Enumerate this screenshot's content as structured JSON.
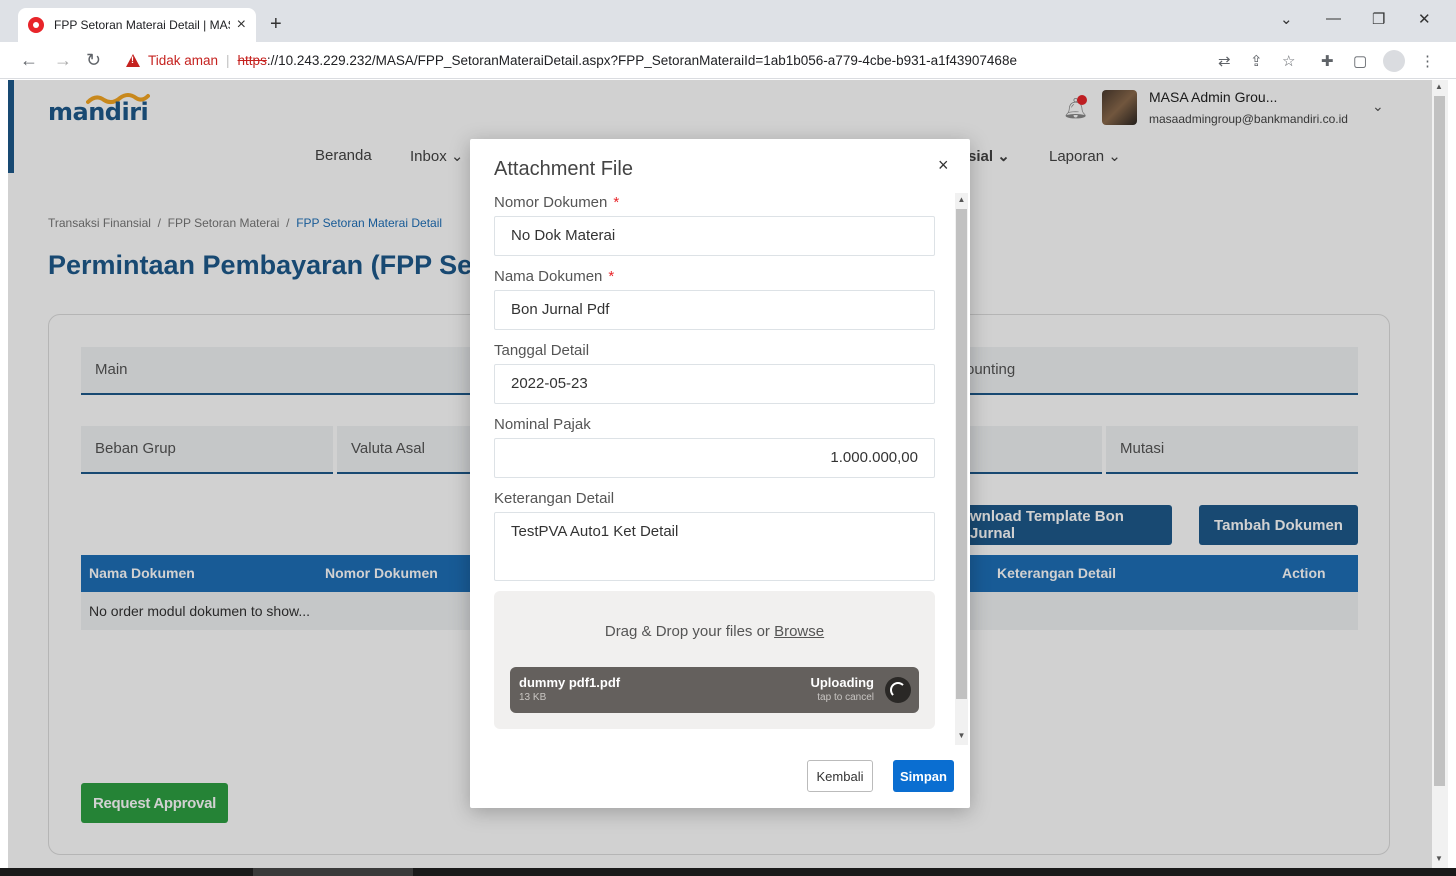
{
  "browser": {
    "tab_title": "FPP Setoran Materai Detail | MAS",
    "new_tab": "+",
    "close_tab": "×",
    "not_secure": "Tidak aman",
    "url_scheme": "https",
    "url_rest": "://10.243.229.232/MASA/FPP_SetoranMateraiDetail.aspx?FPP_SetoranMateraiId=1ab1b056-a779-4cbe-b931-a1f43907468e"
  },
  "header": {
    "logo": "mandiri",
    "user_name": "MASA Admin Grou...",
    "user_email": "masaadmingroup@bankmandiri.co.id",
    "nav": [
      "Beranda",
      "Inbox",
      "sial",
      "Laporan"
    ]
  },
  "breadcrumb": [
    "Transaksi Finansial",
    "FPP Setoran Materai",
    "FPP Setoran Materai Detail"
  ],
  "page_title": "Permintaan Pembayaran (FPP Seto",
  "tabs": {
    "main": "Main",
    "accounting": "ounting"
  },
  "fields": {
    "beban_grup": "Beban Grup",
    "valuta_asal": "Valuta Asal",
    "mutasi": "Mutasi"
  },
  "buttons": {
    "download_template": "wnload Template Bon Jurnal",
    "tambah_dokumen": "Tambah Dokumen",
    "request_approval": "Request Approval"
  },
  "table": {
    "columns": [
      "Nama Dokumen",
      "Nomor Dokumen",
      "Keterangan Detail",
      "Action"
    ],
    "empty": "No order modul dokumen to show..."
  },
  "modal": {
    "title": "Attachment File",
    "close": "×",
    "nomor_dokumen_label": "Nomor Dokumen",
    "nomor_dokumen_value": "No Dok Materai",
    "nama_dokumen_label": "Nama Dokumen",
    "nama_dokumen_value": "Bon Jurnal Pdf",
    "tanggal_label": "Tanggal Detail",
    "tanggal_value": "2022-05-23",
    "nominal_label": "Nominal Pajak",
    "nominal_value": "1.000.000,00",
    "keterangan_label": "Keterangan Detail",
    "keterangan_value": "TestPVA Auto1 Ket Detail",
    "required_mark": "*",
    "dropzone_text": "Drag & Drop your files or",
    "dropzone_browse": "Browse",
    "file": {
      "name": "dummy pdf1.pdf",
      "size": "13 KB",
      "status": "Uploading",
      "cancel_hint": "tap to cancel"
    },
    "kembali": "Kembali",
    "simpan": "Simpan"
  },
  "colors": {
    "brand": "#1e5a8c",
    "table_header": "#1e6fb8",
    "approve": "#2ea043",
    "simpan": "#0a6ed1"
  }
}
